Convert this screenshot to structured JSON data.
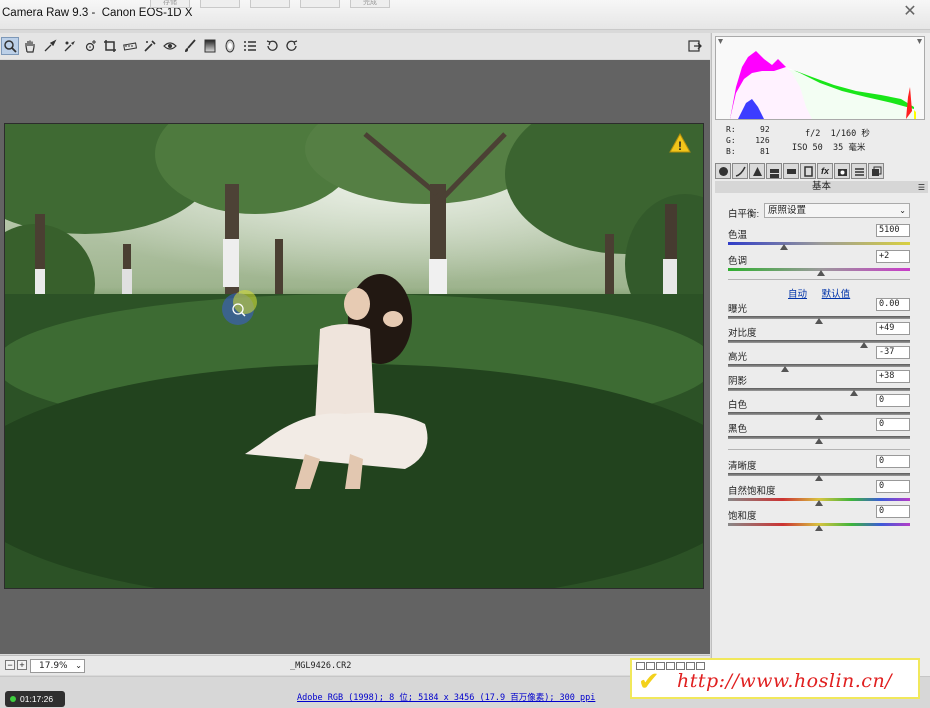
{
  "window": {
    "title": "Camera Raw 9.3 -  Canon EOS-1D X",
    "ghost_tabs": [
      "存储",
      "",
      "",
      "",
      "完成"
    ],
    "close_glyph": "✕"
  },
  "toolbar": {
    "tools": [
      "zoom-tool",
      "hand-tool",
      "white-balance-tool",
      "color-sampler-tool",
      "targeted-adjustment-tool",
      "crop-tool",
      "straighten-tool",
      "spot-removal-tool",
      "red-eye-removal-tool",
      "adjustment-brush-tool",
      "graduated-filter-tool",
      "radial-filter-tool",
      "preferences",
      "rotate-left",
      "rotate-right"
    ],
    "fullscreen_icon": "fullscreen-toggle-icon"
  },
  "preview": {
    "warning_icon": "⚠"
  },
  "statusbar": {
    "zoom_out": "−",
    "zoom_in": "+",
    "zoom_value": "17.9%",
    "filename": "_MGL9426.CR2"
  },
  "bottombar": {
    "timer": "01:17:26",
    "workflow_link": "Adobe RGB (1998); 8 位; 5184 x 3456 (17.9 百万像素); 300 ppi"
  },
  "info": {
    "r_label": "R:",
    "r_value": "92",
    "g_label": "G:",
    "g_value": "126",
    "b_label": "B:",
    "b_value": "81",
    "aperture": "f/2",
    "shutter": "1/160 秒",
    "iso": "ISO 50",
    "focal": "35 毫米"
  },
  "panel": {
    "tab_fx": "fx",
    "section_title": "基本",
    "menu_glyph": "☰",
    "wb_label": "白平衡:",
    "wb_value": "原照设置",
    "auto_link": "自动",
    "default_link": "默认值"
  },
  "sliders": [
    {
      "label": "色温",
      "value": "5100",
      "fraction": 0.31
    },
    {
      "label": "色调",
      "value": "+2",
      "fraction": 0.51
    },
    {
      "label": "曝光",
      "value": "0.00",
      "fraction": 0.5
    },
    {
      "label": "对比度",
      "value": "+49",
      "fraction": 0.745
    },
    {
      "label": "高光",
      "value": "-37",
      "fraction": 0.315
    },
    {
      "label": "阴影",
      "value": "+38",
      "fraction": 0.69
    },
    {
      "label": "白色",
      "value": "0",
      "fraction": 0.5
    },
    {
      "label": "黑色",
      "value": "0",
      "fraction": 0.5
    },
    {
      "label": "清晰度",
      "value": "0",
      "fraction": 0.5
    },
    {
      "label": "自然饱和度",
      "value": "0",
      "fraction": 0.5
    },
    {
      "label": "饱和度",
      "value": "0",
      "fraction": 0.5
    }
  ],
  "watermark": {
    "check": "✔",
    "url": "http://www.hoslin.cn/"
  },
  "colors": {
    "accent": "#bcd0e8",
    "link": "#0000cc",
    "watermark_red": "#e02020",
    "watermark_yellow": "#f3d11b"
  }
}
